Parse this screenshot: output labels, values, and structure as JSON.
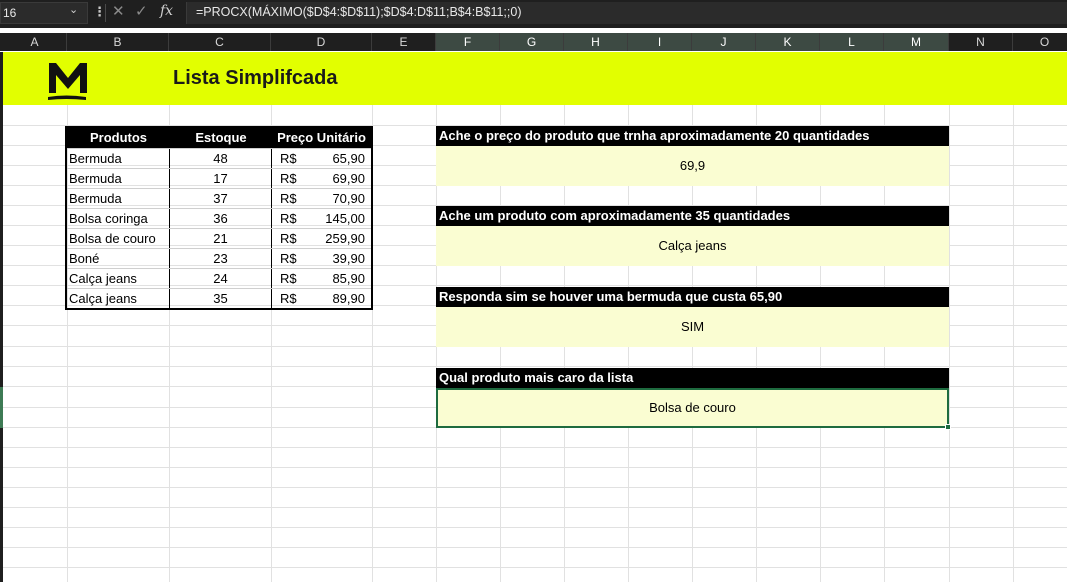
{
  "formula_bar": {
    "name_box": "16",
    "fx_symbol": "fx",
    "formula": "=PROCX(MÁXIMO($D$4:$D$11);$D$4:D$11;B$4:B$11;;0)"
  },
  "columns": [
    "A",
    "B",
    "C",
    "D",
    "E",
    "F",
    "G",
    "H",
    "I",
    "J",
    "K",
    "L",
    "M",
    "N",
    "O"
  ],
  "banner": {
    "title": "Lista Simplifcada",
    "background": "#e2ff00"
  },
  "table": {
    "headers": [
      "Produtos",
      "Estoque",
      "Preço Unitário"
    ],
    "currency": "R$",
    "rows": [
      {
        "produto": "Bermuda",
        "estoque": "48",
        "preco": "65,90"
      },
      {
        "produto": "Bermuda",
        "estoque": "17",
        "preco": "69,90"
      },
      {
        "produto": "Bermuda",
        "estoque": "37",
        "preco": "70,90"
      },
      {
        "produto": "Bolsa coringa",
        "estoque": "36",
        "preco": "145,00"
      },
      {
        "produto": "Bolsa de couro",
        "estoque": "21",
        "preco": "259,90"
      },
      {
        "produto": "Boné",
        "estoque": "23",
        "preco": "39,90"
      },
      {
        "produto": "Calça jeans",
        "estoque": "24",
        "preco": "85,90"
      },
      {
        "produto": "Calça jeans",
        "estoque": "35",
        "preco": "89,90"
      }
    ]
  },
  "questions": [
    {
      "question": "Ache o preço do produto que trnha aproximadamente 20 quantidades",
      "answer": "69,9"
    },
    {
      "question": "Ache um produto com aproximadamente 35 quantidades",
      "answer": "Calça jeans"
    },
    {
      "question": "Responda sim se houver uma bermuda que custa 65,90",
      "answer": "SIM"
    },
    {
      "question": "Qual produto mais caro da lista",
      "answer": "Bolsa de couro"
    }
  ],
  "colors": {
    "accent_green": "#1e6b3f",
    "answer_fill": "#fafdd2"
  }
}
